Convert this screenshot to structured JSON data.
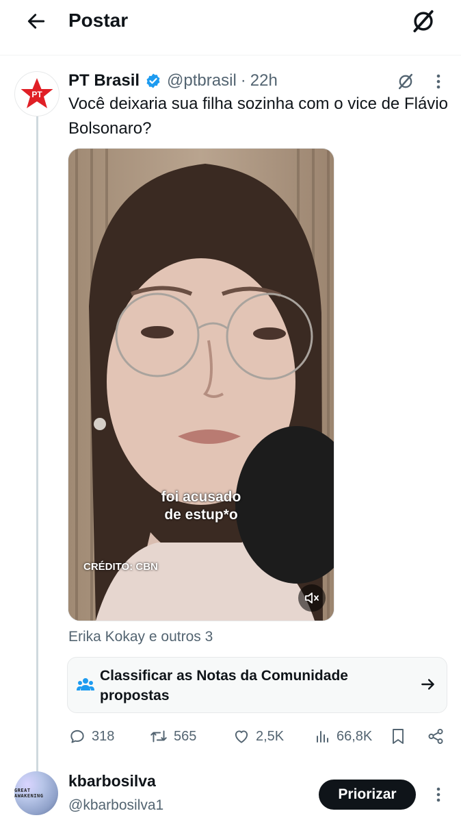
{
  "header": {
    "title": "Postar",
    "back_icon": "arrow-left-icon",
    "grok_icon": "grok-icon"
  },
  "post": {
    "author_name": "PT Brasil",
    "handle": "@ptbrasil",
    "separator": "·",
    "time": "22h",
    "text": "Você deixaria sua filha sozinha com o vice de Flávio Bolsonaro?",
    "avatar_label": "PT",
    "video": {
      "caption_line1": "foi acusado",
      "caption_line2": "de estup*o",
      "credit": "CRÉDITO: CBN"
    },
    "mentions": "Erika Kokay e outros 3",
    "community_notes": {
      "text": "Classificar as Notas da Comunidade propostas"
    },
    "stats": {
      "replies": "318",
      "reposts": "565",
      "likes": "2,5K",
      "views": "66,8K"
    }
  },
  "reply": {
    "name": "kbarbosilva",
    "handle": "@kbarbosilva1",
    "avatar_text": "GREAT AWAKENING",
    "button": "Priorizar"
  },
  "colors": {
    "text": "#0f1419",
    "muted": "#536471",
    "accent": "#1d9bf0",
    "pt_red": "#e01f26",
    "border": "#e7e9ea"
  }
}
